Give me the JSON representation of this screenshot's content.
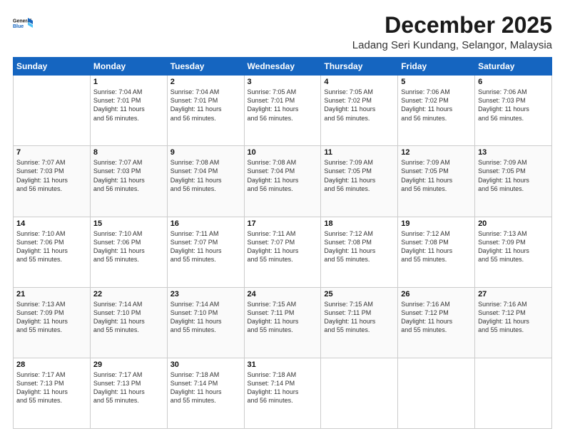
{
  "logo": {
    "line1": "General",
    "line2": "Blue"
  },
  "title": "December 2025",
  "subtitle": "Ladang Seri Kundang, Selangor, Malaysia",
  "headers": [
    "Sunday",
    "Monday",
    "Tuesday",
    "Wednesday",
    "Thursday",
    "Friday",
    "Saturday"
  ],
  "weeks": [
    [
      {
        "day": "",
        "info": ""
      },
      {
        "day": "1",
        "info": "Sunrise: 7:04 AM\nSunset: 7:01 PM\nDaylight: 11 hours\nand 56 minutes."
      },
      {
        "day": "2",
        "info": "Sunrise: 7:04 AM\nSunset: 7:01 PM\nDaylight: 11 hours\nand 56 minutes."
      },
      {
        "day": "3",
        "info": "Sunrise: 7:05 AM\nSunset: 7:01 PM\nDaylight: 11 hours\nand 56 minutes."
      },
      {
        "day": "4",
        "info": "Sunrise: 7:05 AM\nSunset: 7:02 PM\nDaylight: 11 hours\nand 56 minutes."
      },
      {
        "day": "5",
        "info": "Sunrise: 7:06 AM\nSunset: 7:02 PM\nDaylight: 11 hours\nand 56 minutes."
      },
      {
        "day": "6",
        "info": "Sunrise: 7:06 AM\nSunset: 7:03 PM\nDaylight: 11 hours\nand 56 minutes."
      }
    ],
    [
      {
        "day": "7",
        "info": "Sunrise: 7:07 AM\nSunset: 7:03 PM\nDaylight: 11 hours\nand 56 minutes."
      },
      {
        "day": "8",
        "info": "Sunrise: 7:07 AM\nSunset: 7:03 PM\nDaylight: 11 hours\nand 56 minutes."
      },
      {
        "day": "9",
        "info": "Sunrise: 7:08 AM\nSunset: 7:04 PM\nDaylight: 11 hours\nand 56 minutes."
      },
      {
        "day": "10",
        "info": "Sunrise: 7:08 AM\nSunset: 7:04 PM\nDaylight: 11 hours\nand 56 minutes."
      },
      {
        "day": "11",
        "info": "Sunrise: 7:09 AM\nSunset: 7:05 PM\nDaylight: 11 hours\nand 56 minutes."
      },
      {
        "day": "12",
        "info": "Sunrise: 7:09 AM\nSunset: 7:05 PM\nDaylight: 11 hours\nand 56 minutes."
      },
      {
        "day": "13",
        "info": "Sunrise: 7:09 AM\nSunset: 7:05 PM\nDaylight: 11 hours\nand 56 minutes."
      }
    ],
    [
      {
        "day": "14",
        "info": "Sunrise: 7:10 AM\nSunset: 7:06 PM\nDaylight: 11 hours\nand 55 minutes."
      },
      {
        "day": "15",
        "info": "Sunrise: 7:10 AM\nSunset: 7:06 PM\nDaylight: 11 hours\nand 55 minutes."
      },
      {
        "day": "16",
        "info": "Sunrise: 7:11 AM\nSunset: 7:07 PM\nDaylight: 11 hours\nand 55 minutes."
      },
      {
        "day": "17",
        "info": "Sunrise: 7:11 AM\nSunset: 7:07 PM\nDaylight: 11 hours\nand 55 minutes."
      },
      {
        "day": "18",
        "info": "Sunrise: 7:12 AM\nSunset: 7:08 PM\nDaylight: 11 hours\nand 55 minutes."
      },
      {
        "day": "19",
        "info": "Sunrise: 7:12 AM\nSunset: 7:08 PM\nDaylight: 11 hours\nand 55 minutes."
      },
      {
        "day": "20",
        "info": "Sunrise: 7:13 AM\nSunset: 7:09 PM\nDaylight: 11 hours\nand 55 minutes."
      }
    ],
    [
      {
        "day": "21",
        "info": "Sunrise: 7:13 AM\nSunset: 7:09 PM\nDaylight: 11 hours\nand 55 minutes."
      },
      {
        "day": "22",
        "info": "Sunrise: 7:14 AM\nSunset: 7:10 PM\nDaylight: 11 hours\nand 55 minutes."
      },
      {
        "day": "23",
        "info": "Sunrise: 7:14 AM\nSunset: 7:10 PM\nDaylight: 11 hours\nand 55 minutes."
      },
      {
        "day": "24",
        "info": "Sunrise: 7:15 AM\nSunset: 7:11 PM\nDaylight: 11 hours\nand 55 minutes."
      },
      {
        "day": "25",
        "info": "Sunrise: 7:15 AM\nSunset: 7:11 PM\nDaylight: 11 hours\nand 55 minutes."
      },
      {
        "day": "26",
        "info": "Sunrise: 7:16 AM\nSunset: 7:12 PM\nDaylight: 11 hours\nand 55 minutes."
      },
      {
        "day": "27",
        "info": "Sunrise: 7:16 AM\nSunset: 7:12 PM\nDaylight: 11 hours\nand 55 minutes."
      }
    ],
    [
      {
        "day": "28",
        "info": "Sunrise: 7:17 AM\nSunset: 7:13 PM\nDaylight: 11 hours\nand 55 minutes."
      },
      {
        "day": "29",
        "info": "Sunrise: 7:17 AM\nSunset: 7:13 PM\nDaylight: 11 hours\nand 55 minutes."
      },
      {
        "day": "30",
        "info": "Sunrise: 7:18 AM\nSunset: 7:14 PM\nDaylight: 11 hours\nand 55 minutes."
      },
      {
        "day": "31",
        "info": "Sunrise: 7:18 AM\nSunset: 7:14 PM\nDaylight: 11 hours\nand 56 minutes."
      },
      {
        "day": "",
        "info": ""
      },
      {
        "day": "",
        "info": ""
      },
      {
        "day": "",
        "info": ""
      }
    ]
  ]
}
